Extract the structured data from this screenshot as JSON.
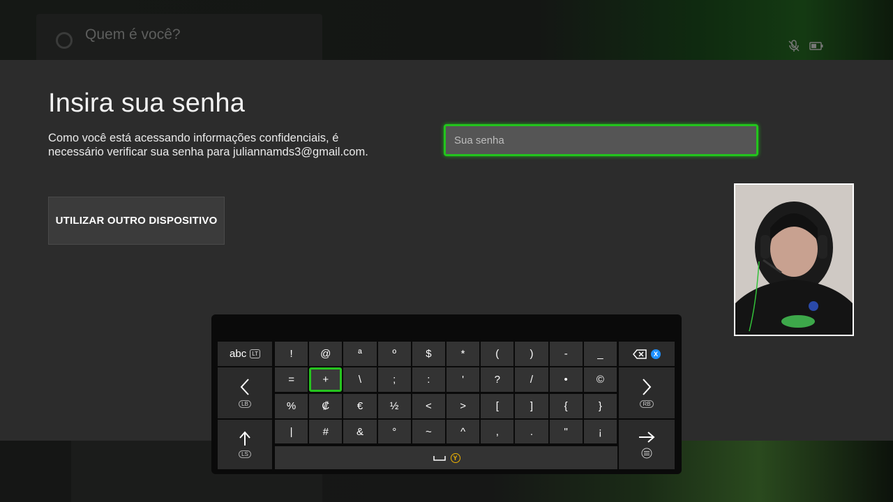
{
  "background": {
    "title": "Quem é você?"
  },
  "dialog": {
    "title": "Insira sua senha",
    "description_line1": "Como você está acessando informações confidenciais, é",
    "description_line2": "necessário verificar sua senha para juliannamds3@gmail.com.",
    "alt_button_label": "UTILIZAR OUTRO DISPOSITIVO",
    "password_placeholder": "Sua senha",
    "password_value": ""
  },
  "keyboard": {
    "abc_label": "abc",
    "abc_badge": "LT",
    "backspace_badge": "X",
    "left_badge": "LB",
    "right_badge": "RB",
    "shift_badge": "LS",
    "space_badge": "Y",
    "row1": [
      "!",
      "@",
      "ª",
      "º",
      "$",
      "*",
      "(",
      ")",
      "-",
      "_"
    ],
    "row2": [
      "=",
      "+",
      "\\",
      ";",
      ":",
      "'",
      "?",
      "/",
      "•",
      "©"
    ],
    "row3": [
      "%",
      "₡",
      "€",
      "½",
      "<",
      ">",
      "[",
      "]",
      "{",
      "}"
    ],
    "row4": [
      "|",
      "#",
      "&",
      "°",
      "~",
      "^",
      ",",
      ".",
      "\"",
      "¡"
    ],
    "colors": {
      "focus": "#26c41f",
      "x_button": "#1e90ff",
      "y_button": "#f0b400"
    }
  }
}
